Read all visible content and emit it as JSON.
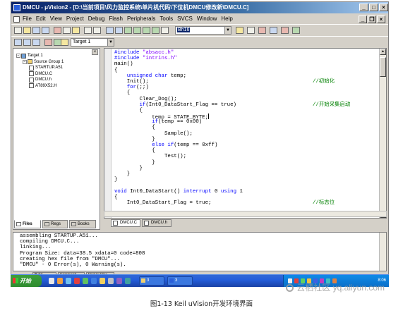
{
  "window": {
    "title": "DMCU - μVision2 - [D:\\当前项目\\风力监控系统\\单片机代码\\下位机DMCU修改新\\DMCU.C]",
    "controls": {
      "minimize": "_",
      "maximize": "□",
      "close": "×"
    }
  },
  "menubar": {
    "items": [
      "File",
      "Edit",
      "View",
      "Project",
      "Debug",
      "Flash",
      "Peripherals",
      "Tools",
      "SVCS",
      "Window",
      "Help"
    ],
    "mdi_controls": {
      "minimize": "_",
      "restore": "❐",
      "close": "×"
    }
  },
  "toolbar1": {
    "find_combo_value": "Bh16",
    "icons": [
      "new-icon",
      "open-icon",
      "save-icon",
      "save-all-icon",
      "cut-icon",
      "copy-icon",
      "paste-icon",
      "undo-icon",
      "redo-icon",
      "indent-icon",
      "unindent-icon",
      "bookmark-icon",
      "prev-bookmark-icon",
      "next-bookmark-icon",
      "clear-bookmark-icon",
      "find-in-files-icon",
      "find-icon",
      "print-icon",
      "debug-icon",
      "window-icon",
      "breakpoint-icon",
      "config-icon"
    ]
  },
  "toolbar2": {
    "target_combo_value": "Target 1",
    "icons": [
      "compile-icon",
      "build-icon",
      "rebuild-icon",
      "stop-build-icon",
      "download-icon",
      "options-icon"
    ]
  },
  "project": {
    "tree": [
      {
        "label": "Target 1",
        "level": 0,
        "kind": "target",
        "expander": "−"
      },
      {
        "label": "Source Group 1",
        "level": 1,
        "kind": "folder",
        "expander": "−"
      },
      {
        "label": "STARTUP.A51",
        "level": 2,
        "kind": "file"
      },
      {
        "label": "DMCU.C",
        "level": 2,
        "kind": "file"
      },
      {
        "label": "DMCU.h",
        "level": 2,
        "kind": "file"
      },
      {
        "label": "AT89X52.H",
        "level": 2,
        "kind": "file"
      }
    ],
    "tabs": [
      "Files",
      "Regs",
      "Books"
    ]
  },
  "editor": {
    "lines": [
      {
        "tokens": [
          {
            "t": "#include ",
            "c": "kw"
          },
          {
            "t": "\"absacc.h\"",
            "c": "str"
          }
        ]
      },
      {
        "tokens": [
          {
            "t": "#include ",
            "c": "kw"
          },
          {
            "t": "\"intrins.h\"",
            "c": "str"
          }
        ]
      },
      {
        "tokens": [
          {
            "t": "main()",
            "c": ""
          }
        ]
      },
      {
        "tokens": [
          {
            "t": "{",
            "c": ""
          }
        ]
      },
      {
        "tokens": [
          {
            "t": "    ",
            "c": ""
          },
          {
            "t": "unsigned char",
            "c": "kw"
          },
          {
            "t": " temp;",
            "c": ""
          }
        ]
      },
      {
        "tokens": [
          {
            "t": "    Init();",
            "c": ""
          }
        ],
        "comment": "//初始化"
      },
      {
        "tokens": [
          {
            "t": "    ",
            "c": ""
          },
          {
            "t": "for",
            "c": "kw"
          },
          {
            "t": "(;;)",
            "c": ""
          }
        ]
      },
      {
        "tokens": [
          {
            "t": "    {",
            "c": ""
          }
        ]
      },
      {
        "tokens": [
          {
            "t": "        Clear_Dog();",
            "c": ""
          }
        ]
      },
      {
        "tokens": [
          {
            "t": "        ",
            "c": ""
          },
          {
            "t": "if",
            "c": "kw"
          },
          {
            "t": "(Int0_DataStart_Flag == true)",
            "c": ""
          }
        ],
        "comment": "//开始采集启动"
      },
      {
        "tokens": [
          {
            "t": "        {",
            "c": ""
          }
        ]
      },
      {
        "tokens": [
          {
            "t": "            temp = STATE_BYTE;",
            "c": ""
          }
        ],
        "cursor": true
      },
      {
        "tokens": [
          {
            "t": "            ",
            "c": ""
          },
          {
            "t": "if",
            "c": "kw"
          },
          {
            "t": "(temp == 0x00)",
            "c": ""
          }
        ]
      },
      {
        "tokens": [
          {
            "t": "            {",
            "c": ""
          }
        ]
      },
      {
        "tokens": [
          {
            "t": "                Sample();",
            "c": ""
          }
        ]
      },
      {
        "tokens": [
          {
            "t": "            }",
            "c": ""
          }
        ]
      },
      {
        "tokens": [
          {
            "t": "            ",
            "c": ""
          },
          {
            "t": "else if",
            "c": "kw"
          },
          {
            "t": "(temp == 0xff)",
            "c": ""
          }
        ]
      },
      {
        "tokens": [
          {
            "t": "            {",
            "c": ""
          }
        ]
      },
      {
        "tokens": [
          {
            "t": "                Test();",
            "c": ""
          }
        ]
      },
      {
        "tokens": [
          {
            "t": "            }",
            "c": ""
          }
        ]
      },
      {
        "tokens": [
          {
            "t": "        }",
            "c": ""
          }
        ]
      },
      {
        "tokens": [
          {
            "t": "    }",
            "c": ""
          }
        ]
      },
      {
        "tokens": [
          {
            "t": "}",
            "c": ""
          }
        ]
      },
      {
        "tokens": [
          {
            "t": "",
            "c": ""
          }
        ]
      },
      {
        "tokens": [
          {
            "t": "void",
            "c": "kw"
          },
          {
            "t": " Int0_DataStart() ",
            "c": ""
          },
          {
            "t": "interrupt",
            "c": "kw"
          },
          {
            "t": " 0 ",
            "c": ""
          },
          {
            "t": "using",
            "c": "kw"
          },
          {
            "t": " 1",
            "c": ""
          }
        ]
      },
      {
        "tokens": [
          {
            "t": "{",
            "c": ""
          }
        ]
      },
      {
        "tokens": [
          {
            "t": "    Int0_DataStart_Flag = true;",
            "c": ""
          }
        ],
        "comment": "//标志位"
      }
    ],
    "doc_tabs": [
      "DMCU.C",
      "DMCU.h"
    ]
  },
  "output": {
    "lines": [
      "assembling STARTUP.A51...",
      "compiling DMCU.C...",
      "linking...",
      "Program Size: data=38.5 xdata=0 code=808",
      "creating hex file from \"DMCU\"...",
      "\"DMCU\" - 0 Error(s), 0 Warning(s)."
    ],
    "tabs": [
      "Build",
      "Command",
      "Find in Files"
    ]
  },
  "taskbar": {
    "start_label": "开始",
    "tasks": [
      {
        "label": "3"
      },
      {
        "label": "3"
      }
    ],
    "clock": "8:06"
  },
  "watermark": "云栖社区 yq.aliyun.com",
  "caption": "图1-13 Keil uVision开发环境界面",
  "colors": {
    "title_start": "#0a246a",
    "keyword": "#0000ff",
    "string": "#8000ff",
    "comment": "#008000",
    "taskbar": "#245edb",
    "start_button": "#3c9f3c"
  }
}
